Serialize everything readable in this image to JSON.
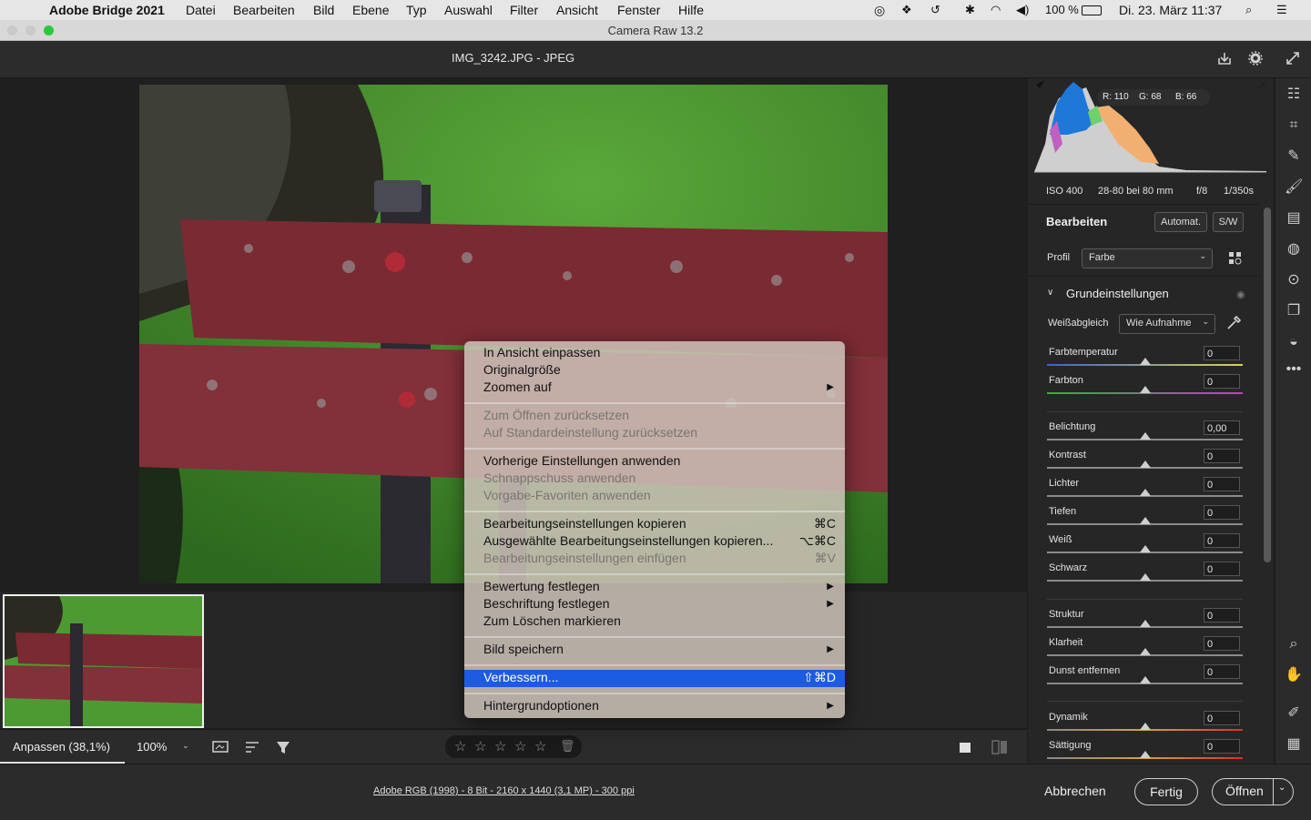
{
  "menubar": {
    "app": "Adobe Bridge 2021",
    "items": [
      "Datei",
      "Bearbeiten",
      "Bild",
      "Ebene",
      "Typ",
      "Auswahl",
      "Filter",
      "Ansicht",
      "Fenster",
      "Hilfe"
    ],
    "battery": "100 %",
    "clock": "Di. 23. März  11:37"
  },
  "window": {
    "title": "Camera Raw 13.2"
  },
  "header": {
    "filename": "IMG_3242.JPG  -  JPEG"
  },
  "histogram": {
    "r": "R: 110",
    "g": "G: 68",
    "b": "B: 66"
  },
  "camera_info": {
    "iso": "ISO 400",
    "lens": "28-80 bei 80 mm",
    "aperture": "f/8",
    "shutter": "1/350s"
  },
  "edit_panel": {
    "title": "Bearbeiten",
    "auto_label": "Automat.",
    "bw_label": "S/W",
    "profile_label": "Profil",
    "profile_value": "Farbe",
    "section_title": "Grundeinstellungen",
    "wb_label": "Weißabgleich",
    "wb_value": "Wie Aufnahme",
    "sliders": [
      {
        "label": "Farbtemperatur",
        "value": "0",
        "pos": 0.5
      },
      {
        "label": "Farbton",
        "value": "0",
        "pos": 0.5
      },
      {
        "label": "Belichtung",
        "value": "0,00",
        "pos": 0.5
      },
      {
        "label": "Kontrast",
        "value": "0",
        "pos": 0.5
      },
      {
        "label": "Lichter",
        "value": "0",
        "pos": 0.5
      },
      {
        "label": "Tiefen",
        "value": "0",
        "pos": 0.5
      },
      {
        "label": "Weiß",
        "value": "0",
        "pos": 0.5
      },
      {
        "label": "Schwarz",
        "value": "0",
        "pos": 0.5
      },
      {
        "label": "Struktur",
        "value": "0",
        "pos": 0.5
      },
      {
        "label": "Klarheit",
        "value": "0",
        "pos": 0.5
      },
      {
        "label": "Dunst entfernen",
        "value": "0",
        "pos": 0.5
      },
      {
        "label": "Dynamik",
        "value": "0",
        "pos": 0.5
      },
      {
        "label": "Sättigung",
        "value": "0",
        "pos": 0.5
      }
    ]
  },
  "context_menu": {
    "items": [
      {
        "label": "In Ansicht einpassen",
        "shortcut": "",
        "submenu": false,
        "disabled": false
      },
      {
        "label": "Originalgröße",
        "shortcut": "",
        "submenu": false,
        "disabled": false
      },
      {
        "label": "Zoomen auf",
        "shortcut": "",
        "submenu": true,
        "disabled": false
      },
      {
        "label": "Zum Öffnen zurücksetzen",
        "shortcut": "",
        "submenu": false,
        "disabled": true
      },
      {
        "label": "Auf Standardeinstellung zurücksetzen",
        "shortcut": "",
        "submenu": false,
        "disabled": true
      },
      {
        "label": "Vorherige Einstellungen anwenden",
        "shortcut": "",
        "submenu": false,
        "disabled": false
      },
      {
        "label": "Schnappschuss anwenden",
        "shortcut": "",
        "submenu": false,
        "disabled": true
      },
      {
        "label": "Vorgabe-Favoriten anwenden",
        "shortcut": "",
        "submenu": false,
        "disabled": true
      },
      {
        "label": "Bearbeitungseinstellungen kopieren",
        "shortcut": "⌘C",
        "submenu": false,
        "disabled": false
      },
      {
        "label": "Ausgewählte Bearbeitungseinstellungen kopieren...",
        "shortcut": "⌥⌘C",
        "submenu": false,
        "disabled": false
      },
      {
        "label": "Bearbeitungseinstellungen einfügen",
        "shortcut": "⌘V",
        "submenu": false,
        "disabled": true
      },
      {
        "label": "Bewertung festlegen",
        "shortcut": "",
        "submenu": true,
        "disabled": false
      },
      {
        "label": "Beschriftung festlegen",
        "shortcut": "",
        "submenu": true,
        "disabled": false
      },
      {
        "label": "Zum Löschen markieren",
        "shortcut": "",
        "submenu": false,
        "disabled": false
      },
      {
        "label": "Bild speichern",
        "shortcut": "",
        "submenu": true,
        "disabled": false
      },
      {
        "label": "Verbessern...",
        "shortcut": "⇧⌘D",
        "submenu": false,
        "disabled": false,
        "highlighted": true
      },
      {
        "label": "Hintergrundoptionen",
        "shortcut": "",
        "submenu": true,
        "disabled": false
      }
    ]
  },
  "bottombar": {
    "fit": "Anpassen (38,1%)",
    "zoom": "100%"
  },
  "statusbar": {
    "info": "Adobe RGB (1998) - 8 Bit - 2160 x 1440 (3,1 MP) - 300 ppi",
    "cancel": "Abbrechen",
    "done": "Fertig",
    "open": "Öffnen"
  },
  "colors": {
    "highlight": "#1d5be0",
    "panel": "#262626",
    "accent_red": "#7a2a32"
  }
}
